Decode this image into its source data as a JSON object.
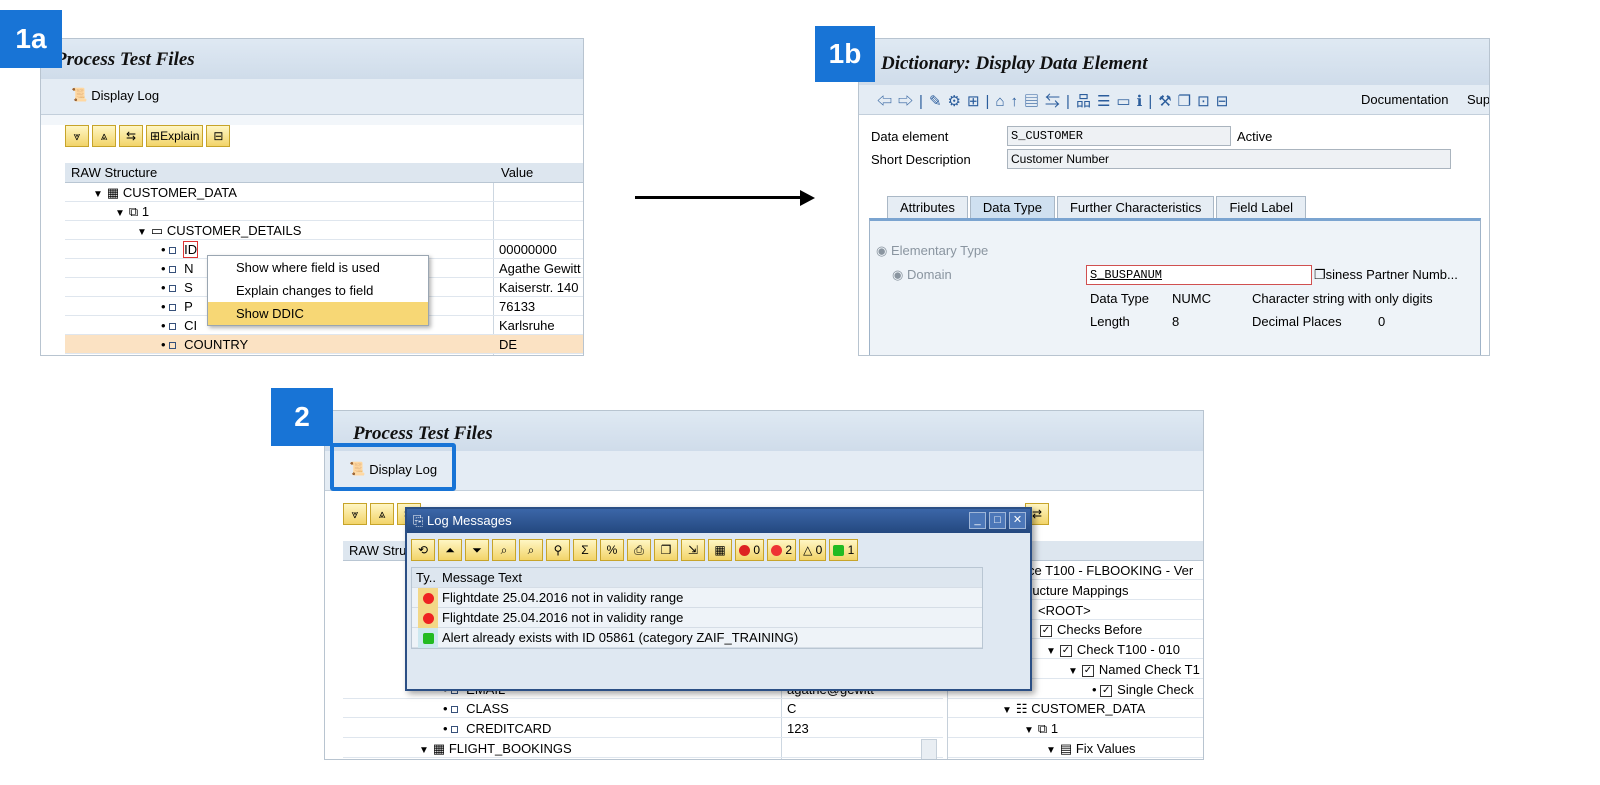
{
  "labels": {
    "a": "1a",
    "b": "1b",
    "c": "2"
  },
  "panel1a": {
    "title": "Process Test Files",
    "display_log": "Display Log",
    "explain": "Explain",
    "col_struct": "RAW Structure",
    "col_value": "Value",
    "tree": [
      {
        "text": "CUSTOMER_DATA",
        "value": ""
      },
      {
        "text": "1",
        "value": ""
      },
      {
        "text": "CUSTOMER_DETAILS",
        "value": ""
      },
      {
        "text": "ID",
        "value": "00000000"
      },
      {
        "text": "N",
        "value": "Agathe Gewitt"
      },
      {
        "text": "S",
        "value": "Kaiserstr. 140"
      },
      {
        "text": "P",
        "value": "76133"
      },
      {
        "text": "CI",
        "value": "Karlsruhe"
      },
      {
        "text": "COUNTRY",
        "value": "DE"
      }
    ],
    "context_menu": [
      "Show where field is used",
      "Explain changes to field",
      "Show DDIC"
    ]
  },
  "panel1b": {
    "title": "Dictionary: Display Data Element",
    "documentation": "Documentation",
    "sup": "Sup",
    "data_element_label": "Data element",
    "data_element_value": "S_CUSTOMER",
    "status": "Active",
    "short_desc_label": "Short Description",
    "short_desc_value": "Customer Number",
    "tabs": [
      "Attributes",
      "Data Type",
      "Further Characteristics",
      "Field Label"
    ],
    "elementary_type": "Elementary Type",
    "domain": "Domain",
    "domain_value": "S_BUSPANUM",
    "domain_desc": "siness Partner Numb...",
    "data_type_label": "Data Type",
    "data_type_value": "NUMC",
    "data_type_desc": "Character string with only digits",
    "length_label": "Length",
    "length_value": "8",
    "decimal_label": "Decimal Places",
    "decimal_value": "0"
  },
  "panel2": {
    "title": "Process Test Files",
    "display_log": "Display Log",
    "col_struct": "RAW Stru",
    "left_rows": [
      {
        "text": "EMAIL",
        "value": "agathe@gewitt"
      },
      {
        "text": "CLASS",
        "value": "C"
      },
      {
        "text": "CREDITCARD",
        "value": "123"
      },
      {
        "text": "FLIGHT_BOOKINGS",
        "value": ""
      }
    ],
    "right_rows": [
      "ce T100 - FLBOOKING - Ver",
      "ructure Mappings",
      "<ROOT>",
      "Checks Before",
      "Check T100 - 010",
      "Named Check T1",
      "Single Check",
      "CUSTOMER_DATA",
      "1",
      "Fix Values"
    ]
  },
  "dialog": {
    "title": "Log Messages",
    "counts": {
      "stop": "0",
      "error": "2",
      "warning": "0",
      "success": "1"
    },
    "col_type": "Ty..",
    "col_text": "Message Text",
    "messages": [
      {
        "type": "error",
        "text": "Flightdate 25.04.2016 not in validity range"
      },
      {
        "type": "error",
        "text": "Flightdate 25.04.2016 not in validity range"
      },
      {
        "type": "success",
        "text": "Alert already exists with ID 05861 (category ZAIF_TRAINING)"
      }
    ]
  },
  "colors": {
    "badge": "#1874d6",
    "selected_row": "#fbe2c3",
    "menu_highlight": "#f7d775"
  }
}
